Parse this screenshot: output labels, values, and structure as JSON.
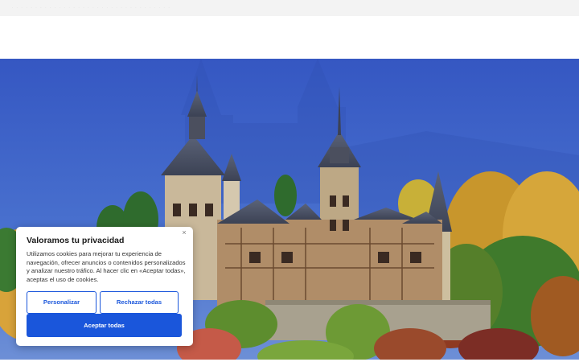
{
  "topbar": {
    "text": "· · · · · · · · · · · · · · · · · · · · · · · · · · · · · · · · · ·"
  },
  "cookie_banner": {
    "title": "Valoramos tu privacidad",
    "body": "Utilizamos cookies para mejorar tu experiencia de navegación, ofrecer anuncios o contenidos personalizados y analizar nuestro tráfico. Al hacer clic en «Aceptar todas», aceptas el uso de cookies.",
    "customize_label": "Personalizar",
    "reject_label": "Rechazar todas",
    "accept_label": "Aceptar todas",
    "close_glyph": "×"
  },
  "colors": {
    "accent": "#1a56db",
    "hero_sky": "#3d62c7"
  },
  "icons": {
    "close": "close-icon"
  }
}
